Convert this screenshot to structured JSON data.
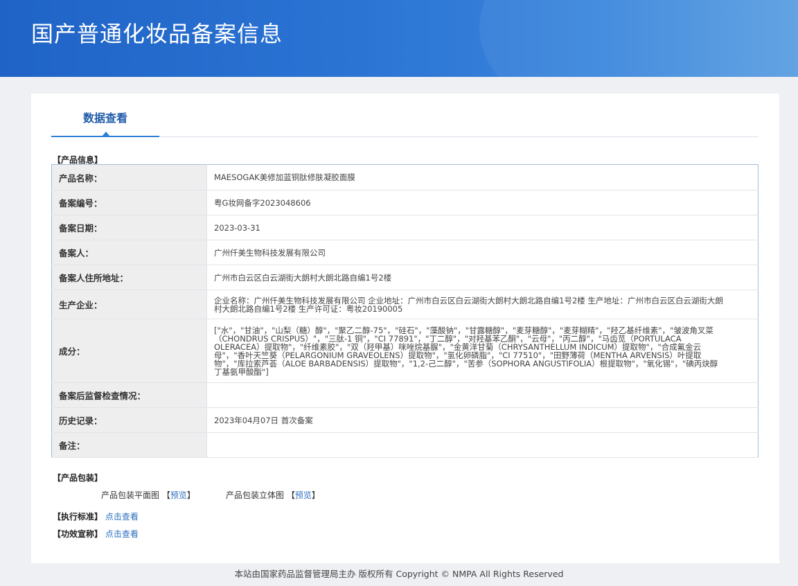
{
  "header": {
    "title": "国产普通化妆品备案信息"
  },
  "tabs": [
    {
      "label": "数据查看"
    }
  ],
  "product_info": {
    "section_title": "【产品信息】",
    "rows": [
      {
        "label": "产品名称：",
        "value": "MAESOGAK美修加蓝铜肽修肤凝胶面膜"
      },
      {
        "label": "备案编号：",
        "value": "粤G妆网备字2023048606"
      },
      {
        "label": "备案日期：",
        "value": "2023-03-31"
      },
      {
        "label": "备案人：",
        "value": "广州仟美生物科技发展有限公司"
      },
      {
        "label": "备案人住所地址：",
        "value": "广州市白云区白云湖街大朗村大朗北路自编1号2楼"
      },
      {
        "label": "生产企业：",
        "value": "企业名称：广州仟美生物科技发展有限公司 企业地址：广州市白云区白云湖街大朗村大朗北路自编1号2楼 生产地址：广州市白云区白云湖街大朗村大朗北路自编1号2楼 生产许可证：粤妆20190005"
      },
      {
        "label": "成分：",
        "value": "[\"水\"，\"甘油\"，\"山梨（糖）醇\"，\"聚乙二醇-75\"，\"硅石\"，\"藻酸钠\"，\"甘露糖醇\"，\"麦芽糖醇\"，\"麦芽糊精\"，\"羟乙基纤维素\"，\"皱波角叉菜（CHONDRUS CRISPUS）\"，\"三肽-1 铜\"，\"CI 77891\"，\"丁二醇\"，\"对羟基苯乙酮\"，\"云母\"，\"丙二醇\"，\"马齿苋（PORTULACA OLERACEA）提取物\"，\"纤维素胶\"，\"双（羟甲基）咪唑烷基脲\"，\"金黄洋甘菊（CHRYSANTHELLUM INDICUM）提取物\"，\"合成氟金云母\"，\"香叶天竺葵（PELARGONIUM GRAVEOLENS）提取物\"，\"氢化卵磷脂\"，\"CI 77510\"，\"田野薄荷（MENTHA ARVENSIS）叶提取物\"，\"库拉索芦荟（ALOE BARBADENSIS）提取物\"，\"1,2-己二醇\"，\"苦参（SOPHORA ANGUSTIFOLIA）根提取物\"，\"氧化锡\"，\"碘丙炔醇丁基氨甲酸酯\"]"
      },
      {
        "label": "备案后监督检查情况：",
        "value": ""
      },
      {
        "label": "历史记录：",
        "value": "2023年04月07日 首次备案"
      },
      {
        "label": "备注：",
        "value": ""
      }
    ]
  },
  "packaging": {
    "section_title": "【产品包装】",
    "flat_label": "产品包装平面图",
    "solid_label": "产品包装立体图",
    "bracket_open": "【",
    "bracket_close": "】",
    "preview_link": "预览"
  },
  "standard": {
    "label": "【执行标准】",
    "link": "点击查看"
  },
  "efficacy": {
    "label": "【功效宣称】",
    "link": "点击查看"
  },
  "footer": {
    "text": "本站由国家药品监督管理局主办 版权所有 Copyright © NMPA All Rights Reserved"
  },
  "colors": {
    "banner": "#2b74d4",
    "accent": "#2d7fd6",
    "link": "#2d6fbf",
    "label_bg": "#eeeeee"
  }
}
